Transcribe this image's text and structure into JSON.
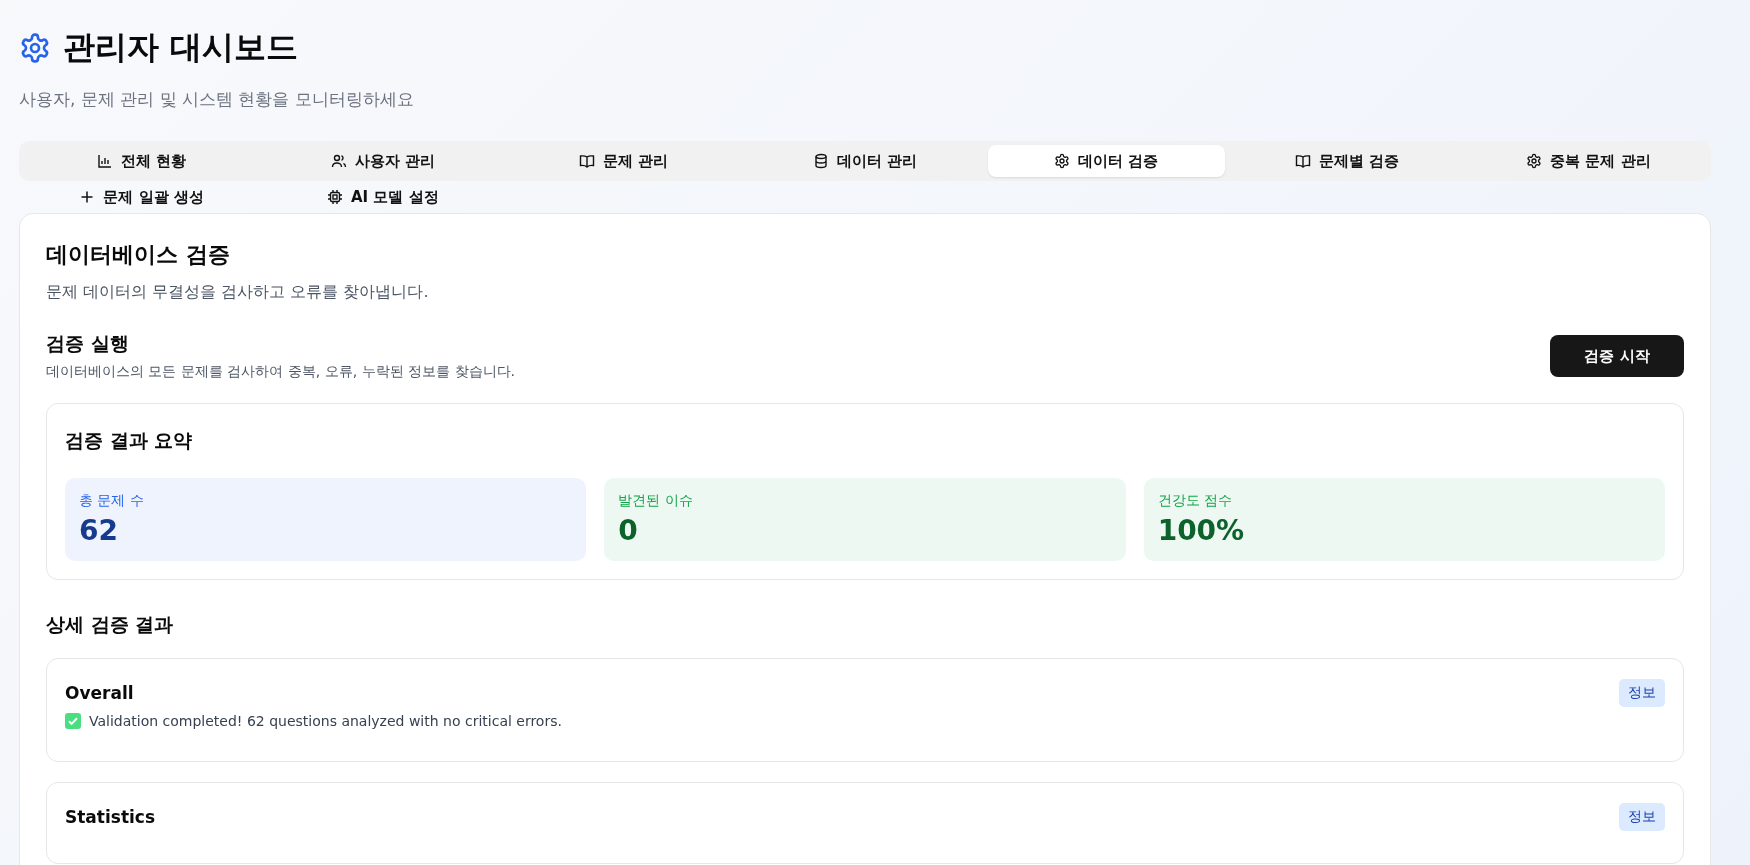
{
  "header": {
    "title": "관리자 대시보드",
    "subtitle": "사용자, 문제 관리 및 시스템 현황을 모니터링하세요"
  },
  "tabs": [
    {
      "label": "전체 현황",
      "selected": false
    },
    {
      "label": "사용자 관리",
      "selected": false
    },
    {
      "label": "문제 관리",
      "selected": false
    },
    {
      "label": "데이터 관리",
      "selected": false
    },
    {
      "label": "데이터 검증",
      "selected": true
    },
    {
      "label": "문제별 검증",
      "selected": false
    },
    {
      "label": "중복 문제 관리",
      "selected": false
    },
    {
      "label": "문제 일괄 생성",
      "selected": false
    },
    {
      "label": "AI 모델 설정",
      "selected": false
    }
  ],
  "panel": {
    "title": "데이터베이스 검증",
    "description": "문제 데이터의 무결성을 검사하고 오류를 찾아냅니다.",
    "run": {
      "title": "검증 실행",
      "description": "데이터베이스의 모든 문제를 검사하여 중복, 오류, 누락된 정보를 찾습니다.",
      "button": "검증 시작"
    },
    "summary": {
      "title": "검증 결과 요약",
      "stats": [
        {
          "label": "총 문제 수",
          "value": "62",
          "color": "#2563eb"
        },
        {
          "label": "발견된 이슈",
          "value": "0",
          "color": "#16a34a"
        },
        {
          "label": "건강도 점수",
          "value": "100%",
          "color": "#16a34a"
        }
      ]
    },
    "details_title": "상세 검증 결과",
    "details": [
      {
        "title": "Overall",
        "badge": "정보",
        "message": "Validation completed! 62 questions analyzed with no critical errors.",
        "check": true
      },
      {
        "title": "Statistics",
        "badge": "정보"
      }
    ]
  }
}
